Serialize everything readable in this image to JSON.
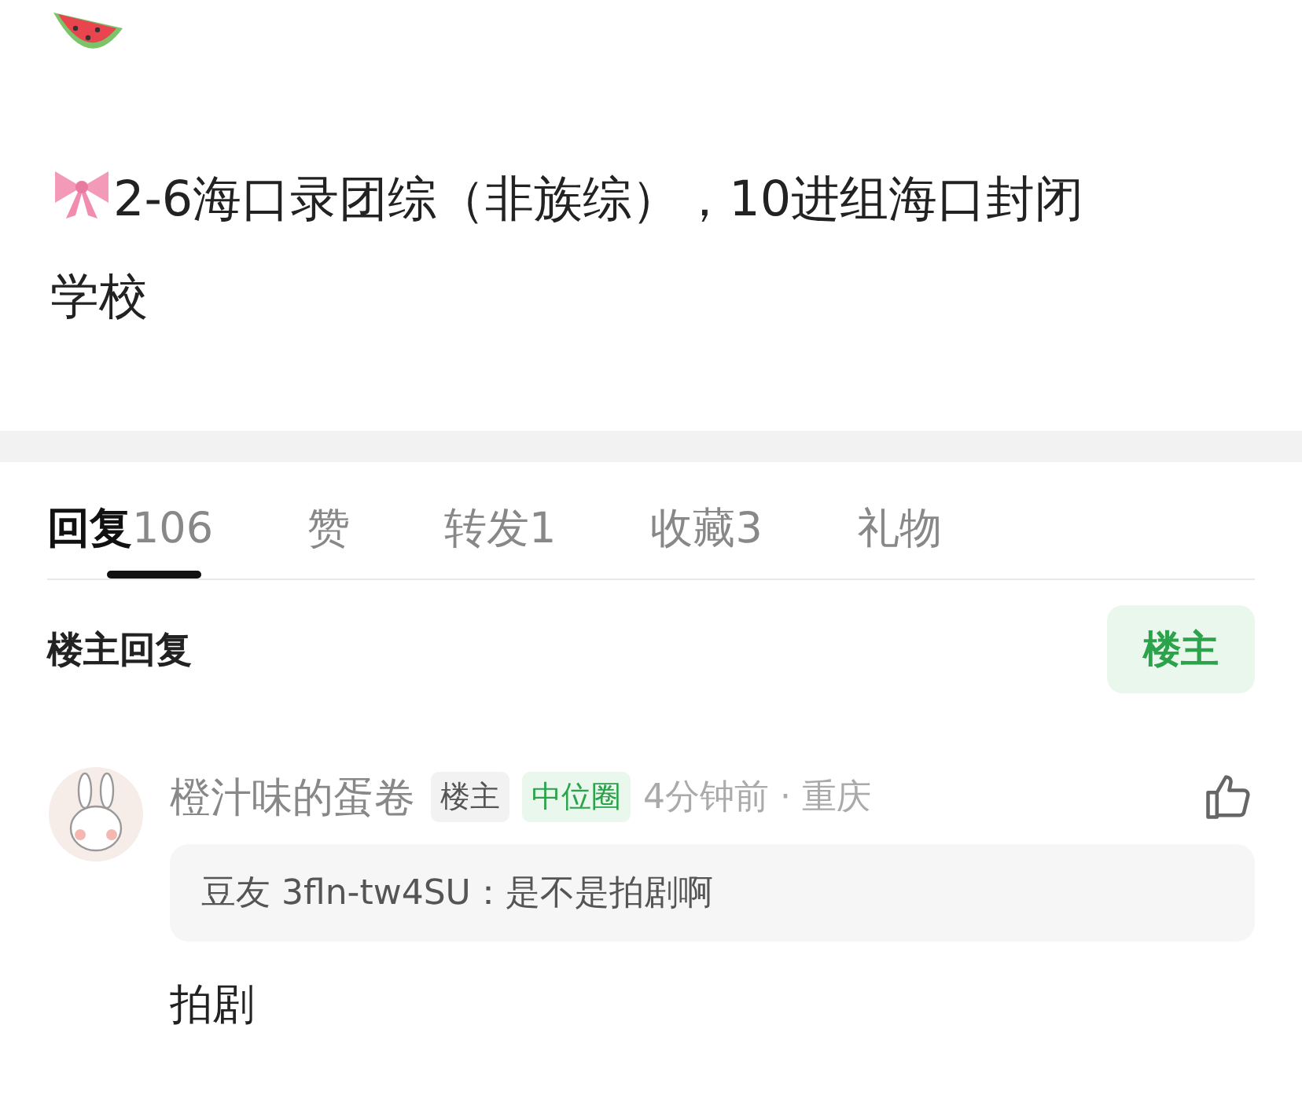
{
  "post": {
    "lines": [
      "2-6海口录团综（非族综），10进组海口封闭",
      "学校"
    ]
  },
  "tabs": [
    {
      "label": "回复",
      "count": "106",
      "selected": true
    },
    {
      "label": "赞",
      "selected": false
    },
    {
      "label": "转发",
      "count": "1",
      "selected": false
    },
    {
      "label": "收藏",
      "count": "3",
      "selected": false
    },
    {
      "label": "礼物",
      "selected": false
    }
  ],
  "section": {
    "title": "楼主回复",
    "filter_button": "楼主"
  },
  "comments": [
    {
      "author": "橙汁味的蛋卷",
      "badges": [
        {
          "label": "楼主",
          "kind": "role"
        },
        {
          "label": "中位圈",
          "kind": "circle"
        }
      ],
      "time": "4分钟前",
      "separator": "·",
      "location": "重庆",
      "quote": "豆友 3fln-tw4SU：是不是拍剧啊",
      "text": "拍剧"
    }
  ]
}
